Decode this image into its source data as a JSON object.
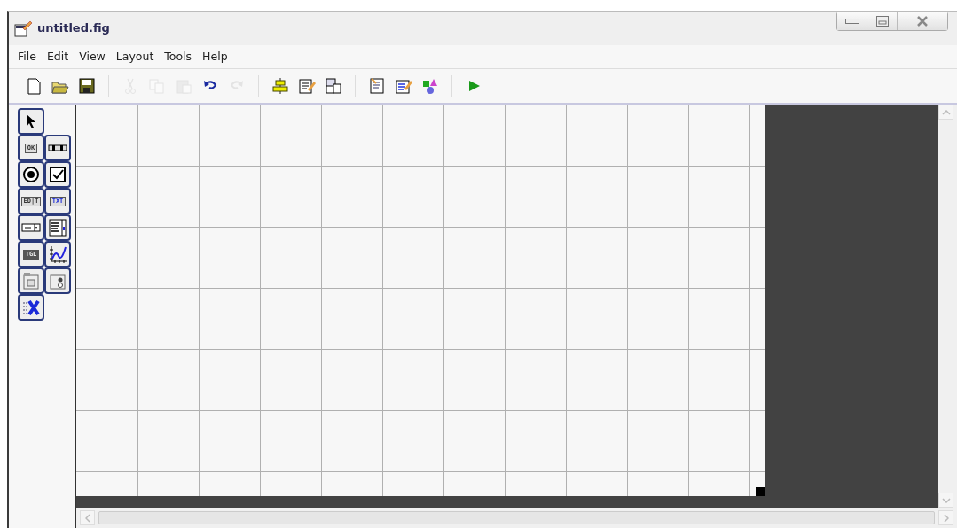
{
  "window": {
    "title": "untitled.fig"
  },
  "menu": [
    "File",
    "Edit",
    "View",
    "Layout",
    "Tools",
    "Help"
  ],
  "toolbar": [
    {
      "kind": "new",
      "disabled": false
    },
    {
      "kind": "open",
      "disabled": false
    },
    {
      "kind": "save",
      "disabled": false
    },
    {
      "kind": "sep"
    },
    {
      "kind": "cut",
      "disabled": true
    },
    {
      "kind": "copy",
      "disabled": true
    },
    {
      "kind": "paste",
      "disabled": true
    },
    {
      "kind": "undo",
      "disabled": false
    },
    {
      "kind": "redo",
      "disabled": true
    },
    {
      "kind": "sep"
    },
    {
      "kind": "align",
      "disabled": false
    },
    {
      "kind": "menueditor",
      "disabled": false
    },
    {
      "kind": "taborder",
      "disabled": false
    },
    {
      "kind": "sep"
    },
    {
      "kind": "mfile",
      "disabled": false
    },
    {
      "kind": "inspector",
      "disabled": false
    },
    {
      "kind": "browser",
      "disabled": false
    },
    {
      "kind": "sep"
    },
    {
      "kind": "run",
      "disabled": false
    }
  ],
  "palette": [
    {
      "kind": "select"
    },
    {
      "kind": "text-button",
      "label": "OK"
    },
    {
      "kind": "slider"
    },
    {
      "kind": "radio"
    },
    {
      "kind": "checkbox"
    },
    {
      "kind": "text-button",
      "label": "ED|T"
    },
    {
      "kind": "text-button",
      "label": "TXT",
      "blue": true
    },
    {
      "kind": "popup"
    },
    {
      "kind": "listbox"
    },
    {
      "kind": "text-button",
      "label": "TGL",
      "dark": true
    },
    {
      "kind": "axes"
    },
    {
      "kind": "panel"
    },
    {
      "kind": "buttongroup"
    },
    {
      "kind": "activex"
    }
  ]
}
